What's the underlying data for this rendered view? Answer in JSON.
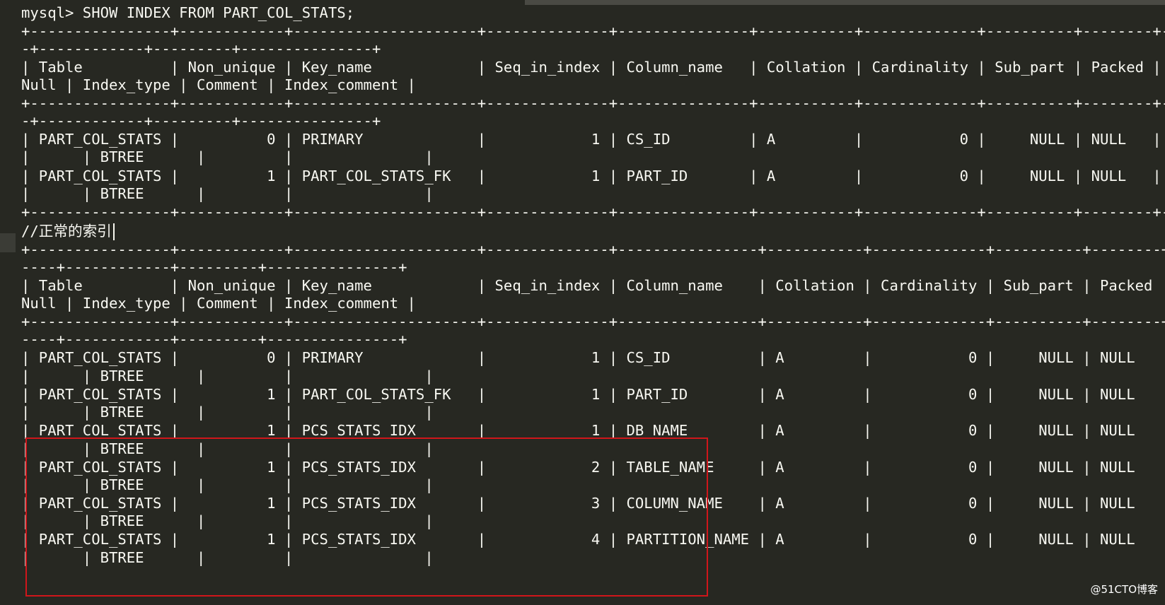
{
  "lines": [
    "mysql> SHOW INDEX FROM PART_COL_STATS;",
    "+----------------+------------+---------------------+--------------+---------------+-----------+-------------+----------+--------+------",
    "-+------------+---------+---------------+",
    "| Table          | Non_unique | Key_name            | Seq_in_index | Column_name   | Collation | Cardinality | Sub_part | Packed |",
    "Null | Index_type | Comment | Index_comment |",
    "+----------------+------------+---------------------+--------------+---------------+-----------+-------------+----------+--------+------",
    "-+------------+---------+---------------+",
    "| PART_COL_STATS |          0 | PRIMARY             |            1 | CS_ID         | A         |           0 |     NULL | NULL   |",
    "|      | BTREE      |         |               |",
    "| PART_COL_STATS |          1 | PART_COL_STATS_FK   |            1 | PART_ID       | A         |           0 |     NULL | NULL   |",
    "|      | BTREE      |         |               |",
    "+----------------+------------+---------------------+--------------+---------------+-----------+-------------+----------+--------+------",
    "//正常的索引",
    "+----------------+------------+---------------------+--------------+----------------+-----------+-------------+----------+--------+-",
    "----+------------+---------+---------------+",
    "| Table          | Non_unique | Key_name            | Seq_in_index | Column_name    | Collation | Cardinality | Sub_part | Packed |",
    "Null | Index_type | Comment | Index_comment |",
    "+----------------+------------+---------------------+--------------+----------------+-----------+-------------+----------+--------+-",
    "----+------------+---------+---------------+",
    "| PART_COL_STATS |          0 | PRIMARY             |            1 | CS_ID          | A         |           0 |     NULL | NULL   |",
    "|      | BTREE      |         |               |",
    "| PART_COL_STATS |          1 | PART_COL_STATS_FK   |            1 | PART_ID        | A         |           0 |     NULL | NULL   |",
    "|      | BTREE      |         |               |",
    "| PART_COL_STATS |          1 | PCS_STATS_IDX       |            1 | DB_NAME        | A         |           0 |     NULL | NULL   |",
    "|      | BTREE      |         |               |",
    "| PART_COL_STATS |          1 | PCS_STATS_IDX       |            2 | TABLE_NAME     | A         |           0 |     NULL | NULL   |",
    "|      | BTREE      |         |               |",
    "| PART_COL_STATS |          1 | PCS_STATS_IDX       |            3 | COLUMN_NAME    | A         |           0 |     NULL | NULL   |",
    "|      | BTREE      |         |               |",
    "| PART_COL_STATS |          1 | PCS_STATS_IDX       |            4 | PARTITION_NAME | A         |           0 |     NULL | NULL   |",
    "|      | BTREE      |         |               |"
  ],
  "watermark": "@51CTO博客"
}
